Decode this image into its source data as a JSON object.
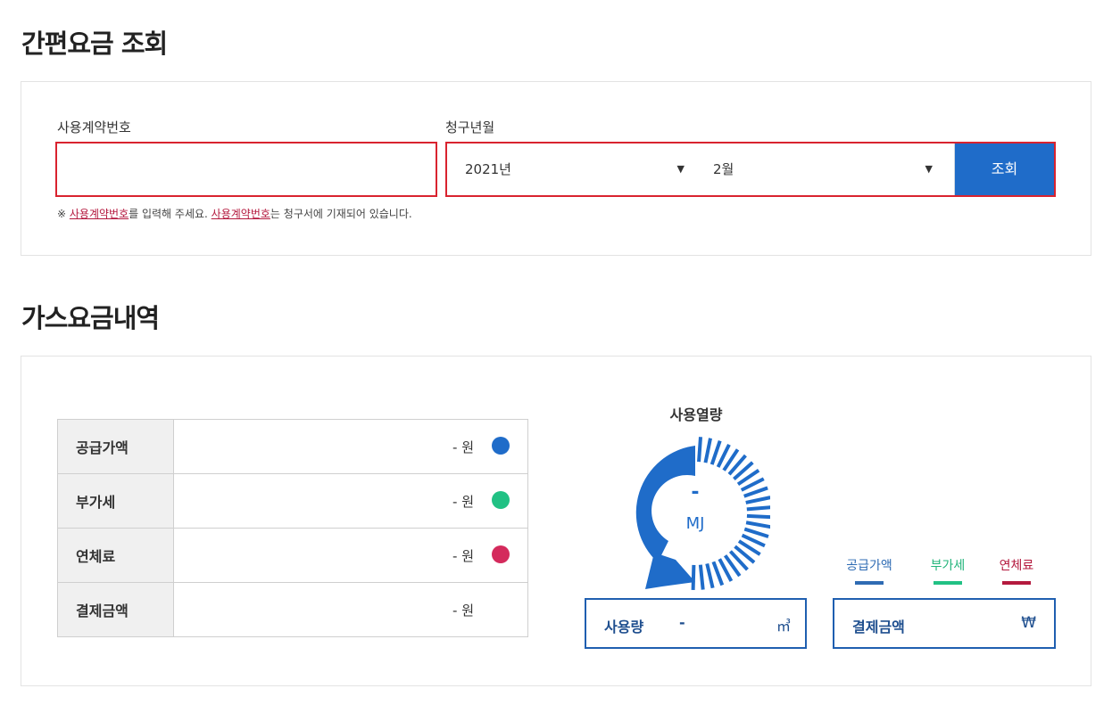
{
  "search_section": {
    "title": "간편요금 조회",
    "contract_label": "사용계약번호",
    "contract_value": "",
    "month_label": "청구년월",
    "year_selected": "2021년",
    "month_selected": "2월",
    "search_button": "조회",
    "note_prefix": "※ ",
    "note_link1": "사용계약번호",
    "note_mid": "를 입력해 주세요. ",
    "note_link2": "사용계약번호",
    "note_suffix": "는 청구서에 기재되어 있습니다."
  },
  "result_section": {
    "title": "가스요금내역",
    "rows": [
      {
        "label": "공급가액",
        "amount": "- 원",
        "color": "#1f6cc9"
      },
      {
        "label": "부가세",
        "amount": "- 원",
        "color": "#21c184"
      },
      {
        "label": "연체료",
        "amount": "- 원",
        "color": "#d42a5c"
      },
      {
        "label": "결제금액",
        "amount": "- 원"
      }
    ],
    "gauge": {
      "title": "사용열량",
      "value": "-",
      "unit": "MJ"
    },
    "usage": {
      "label": "사용량",
      "value": "-",
      "unit": "㎥"
    },
    "legend": [
      {
        "label": "공급가액",
        "color": "#2e6bb3"
      },
      {
        "label": "부가세",
        "color": "#21c184"
      },
      {
        "label": "연체료",
        "color": "#b4193e"
      }
    ],
    "payment": {
      "label": "결제금액",
      "unit": "₩"
    }
  }
}
